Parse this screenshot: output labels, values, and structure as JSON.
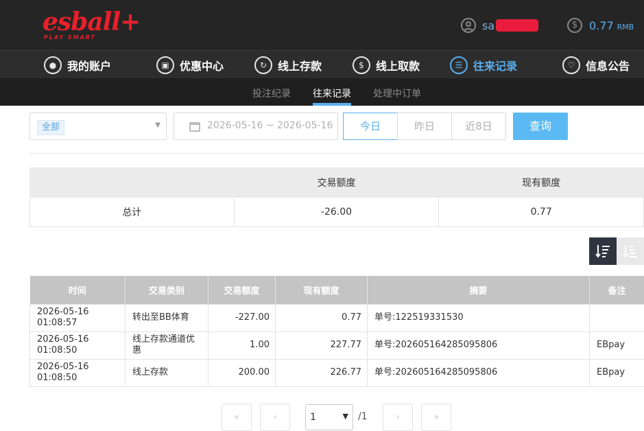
{
  "brand": {
    "logo_text": "esball+",
    "logo_sub": "PLAY SMART"
  },
  "account": {
    "username": "sa",
    "balance": "0.77",
    "currency": "RMB"
  },
  "main_nav": [
    {
      "label": "我的账户",
      "icon": "user-icon"
    },
    {
      "label": "优惠中心",
      "icon": "gift-icon"
    },
    {
      "label": "线上存款",
      "icon": "deposit-icon"
    },
    {
      "label": "线上取款",
      "icon": "withdraw-icon"
    },
    {
      "label": "往来记录",
      "icon": "records-icon",
      "active": true
    },
    {
      "label": "信息公告",
      "icon": "bell-icon"
    }
  ],
  "sub_nav": [
    {
      "label": "投注纪录"
    },
    {
      "label": "往来记录",
      "active": true
    },
    {
      "label": "处理中订单"
    }
  ],
  "filters": {
    "type_tag": "全部",
    "date_range": "2026-05-16 ~ 2026-05-16",
    "buttons": {
      "today": "今日",
      "yesterday": "昨日",
      "last8": "近8日"
    },
    "query": "查询"
  },
  "summary": {
    "headers": [
      "",
      "交易额度",
      "现有额度"
    ],
    "row": [
      "总计",
      "-26.00",
      "0.77"
    ]
  },
  "records": {
    "headers": [
      "时间",
      "交易类别",
      "交易额度",
      "现有额度",
      "摘要",
      "备注"
    ],
    "rows": [
      [
        "2026-05-16 01:08:57",
        "转出至BB体育",
        "-227.00",
        "0.77",
        "单号:122519331530",
        ""
      ],
      [
        "2026-05-16 01:08:50",
        "线上存款通道优惠",
        "1.00",
        "227.77",
        "单号:202605164285095806",
        "EBpay"
      ],
      [
        "2026-05-16 01:08:50",
        "线上存款",
        "200.00",
        "226.77",
        "单号:202605164285095806",
        "EBpay"
      ]
    ]
  },
  "pager": {
    "first": "«",
    "prev": "‹",
    "next": "›",
    "last": "»",
    "page": "1",
    "total": "/1"
  },
  "colors": {
    "accent": "#5ab0f0",
    "brand_red": "#e8202a",
    "header_bg": "#252525"
  }
}
